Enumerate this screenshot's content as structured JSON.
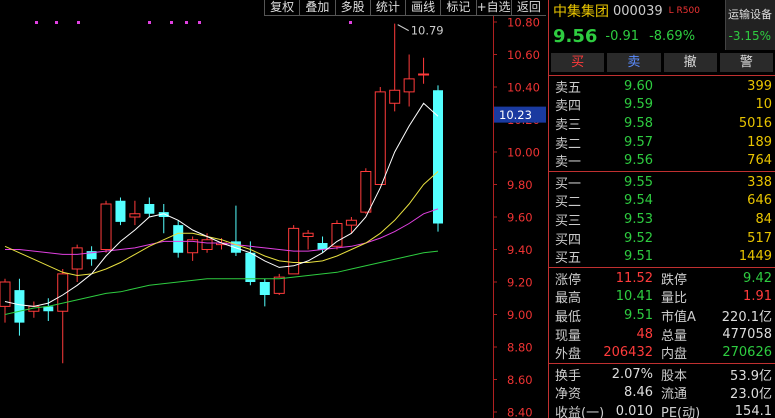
{
  "toolbar": [
    "复权",
    "叠加",
    "多股",
    "统计",
    "画线",
    "标记",
    "+自选",
    "返回"
  ],
  "stock": {
    "name": "中集集团",
    "code": "000039",
    "badge": "L R500",
    "price": "9.56",
    "change": "-0.91",
    "change_pct": "-8.69%",
    "sector_name": "运输设备",
    "sector_pct": "-3.15%"
  },
  "buttons": [
    "买",
    "卖",
    "撤",
    "警"
  ],
  "asks": [
    {
      "label": "卖五",
      "price": "9.60",
      "qty": "399"
    },
    {
      "label": "卖四",
      "price": "9.59",
      "qty": "10"
    },
    {
      "label": "卖三",
      "price": "9.58",
      "qty": "5016"
    },
    {
      "label": "卖二",
      "price": "9.57",
      "qty": "189"
    },
    {
      "label": "卖一",
      "price": "9.56",
      "qty": "764"
    }
  ],
  "bids": [
    {
      "label": "买一",
      "price": "9.55",
      "qty": "338"
    },
    {
      "label": "买二",
      "price": "9.54",
      "qty": "646"
    },
    {
      "label": "买三",
      "price": "9.53",
      "qty": "84"
    },
    {
      "label": "买四",
      "price": "9.52",
      "qty": "517"
    },
    {
      "label": "买五",
      "price": "9.51",
      "qty": "1449"
    }
  ],
  "stats1": [
    {
      "k1": "涨停",
      "v1": "11.52",
      "c1": "red",
      "k2": "跌停",
      "v2": "9.42",
      "c2": "green"
    },
    {
      "k1": "最高",
      "v1": "10.41",
      "c1": "green",
      "k2": "量比",
      "v2": "1.91",
      "c2": "red"
    },
    {
      "k1": "最低",
      "v1": "9.51",
      "c1": "green",
      "k2": "市值A",
      "v2": "220.1亿",
      "c2": "white"
    },
    {
      "k1": "现量",
      "v1": "48",
      "c1": "red",
      "k2": "总量",
      "v2": "477058",
      "c2": "white"
    },
    {
      "k1": "外盘",
      "v1": "206432",
      "c1": "red",
      "k2": "内盘",
      "v2": "270626",
      "c2": "green"
    }
  ],
  "stats2": [
    {
      "k1": "换手",
      "v1": "2.07%",
      "c1": "white",
      "k2": "股本",
      "v2": "53.9亿",
      "c2": "white"
    },
    {
      "k1": "净资",
      "v1": "8.46",
      "c1": "white",
      "k2": "流通",
      "v2": "23.0亿",
      "c2": "white"
    },
    {
      "k1": "收益(一)",
      "v1": "0.010",
      "c1": "white",
      "k2": "PE(动)",
      "v2": "154.1",
      "c2": "white"
    }
  ],
  "chart_data": {
    "type": "candlestick",
    "ylim": [
      8.4,
      10.9
    ],
    "y_ticks": [
      "10.80",
      "10.60",
      "10.40",
      "10.20",
      "10.00",
      "9.80",
      "9.60",
      "9.40",
      "9.20",
      "9.00",
      "8.80",
      "8.60",
      "8.40"
    ],
    "current_price_label": "10.23",
    "max_annotation": "10.79",
    "candles": [
      {
        "o": 9.05,
        "h": 9.22,
        "l": 8.95,
        "c": 9.2
      },
      {
        "o": 9.15,
        "h": 9.22,
        "l": 8.87,
        "c": 8.95
      },
      {
        "o": 9.02,
        "h": 9.08,
        "l": 8.98,
        "c": 9.05
      },
      {
        "o": 9.05,
        "h": 9.1,
        "l": 8.96,
        "c": 9.02
      },
      {
        "o": 9.02,
        "h": 9.28,
        "l": 8.7,
        "c": 9.25
      },
      {
        "o": 9.28,
        "h": 9.43,
        "l": 9.2,
        "c": 9.41
      },
      {
        "o": 9.39,
        "h": 9.42,
        "l": 9.3,
        "c": 9.34
      },
      {
        "o": 9.4,
        "h": 9.7,
        "l": 9.38,
        "c": 9.68
      },
      {
        "o": 9.7,
        "h": 9.72,
        "l": 9.55,
        "c": 9.57
      },
      {
        "o": 9.6,
        "h": 9.7,
        "l": 9.55,
        "c": 9.62
      },
      {
        "o": 9.68,
        "h": 9.72,
        "l": 9.6,
        "c": 9.62
      },
      {
        "o": 9.63,
        "h": 9.68,
        "l": 9.5,
        "c": 9.6
      },
      {
        "o": 9.55,
        "h": 9.58,
        "l": 9.35,
        "c": 9.38
      },
      {
        "o": 9.38,
        "h": 9.48,
        "l": 9.33,
        "c": 9.46
      },
      {
        "o": 9.4,
        "h": 9.5,
        "l": 9.38,
        "c": 9.46
      },
      {
        "o": 9.43,
        "h": 9.47,
        "l": 9.4,
        "c": 9.44
      },
      {
        "o": 9.45,
        "h": 9.67,
        "l": 9.36,
        "c": 9.38
      },
      {
        "o": 9.38,
        "h": 9.45,
        "l": 9.18,
        "c": 9.2
      },
      {
        "o": 9.2,
        "h": 9.22,
        "l": 9.05,
        "c": 9.12
      },
      {
        "o": 9.13,
        "h": 9.25,
        "l": 9.12,
        "c": 9.23
      },
      {
        "o": 9.25,
        "h": 9.55,
        "l": 9.25,
        "c": 9.53
      },
      {
        "o": 9.48,
        "h": 9.52,
        "l": 9.4,
        "c": 9.5
      },
      {
        "o": 9.44,
        "h": 9.48,
        "l": 9.38,
        "c": 9.4
      },
      {
        "o": 9.42,
        "h": 9.58,
        "l": 9.4,
        "c": 9.56
      },
      {
        "o": 9.55,
        "h": 9.6,
        "l": 9.5,
        "c": 9.58
      },
      {
        "o": 9.63,
        "h": 9.9,
        "l": 9.62,
        "c": 9.88
      },
      {
        "o": 9.8,
        "h": 10.4,
        "l": 9.8,
        "c": 10.37
      },
      {
        "o": 10.3,
        "h": 10.79,
        "l": 10.25,
        "c": 10.38
      },
      {
        "o": 10.37,
        "h": 10.6,
        "l": 10.28,
        "c": 10.45
      },
      {
        "o": 10.48,
        "h": 10.58,
        "l": 10.42,
        "c": 10.48
      },
      {
        "o": 10.38,
        "h": 10.41,
        "l": 9.51,
        "c": 9.56
      }
    ],
    "ma_white": [
      9.08,
      9.06,
      9.05,
      9.07,
      9.12,
      9.18,
      9.25,
      9.36,
      9.45,
      9.52,
      9.6,
      9.62,
      9.58,
      9.52,
      9.48,
      9.44,
      9.41,
      9.38,
      9.33,
      9.29,
      9.3,
      9.33,
      9.38,
      9.45,
      9.5,
      9.6,
      9.78,
      10.0,
      10.16,
      10.3,
      10.22
    ],
    "ma_yellow": [
      9.42,
      9.38,
      9.34,
      9.3,
      9.26,
      9.24,
      9.25,
      9.28,
      9.32,
      9.37,
      9.42,
      9.46,
      9.5,
      9.5,
      9.48,
      9.46,
      9.43,
      9.4,
      9.36,
      9.33,
      9.32,
      9.32,
      9.33,
      9.36,
      9.4,
      9.44,
      9.5,
      9.58,
      9.68,
      9.8,
      9.88
    ],
    "ma_magenta": [
      9.4,
      9.4,
      9.39,
      9.38,
      9.37,
      9.37,
      9.38,
      9.39,
      9.4,
      9.41,
      9.43,
      9.45,
      9.45,
      9.45,
      9.44,
      9.44,
      9.43,
      9.42,
      9.41,
      9.4,
      9.39,
      9.39,
      9.4,
      9.41,
      9.42,
      9.44,
      9.47,
      9.51,
      9.56,
      9.62,
      9.65
    ],
    "ma_green": [
      9.0,
      9.02,
      9.04,
      9.05,
      9.07,
      9.09,
      9.11,
      9.13,
      9.14,
      9.16,
      9.18,
      9.19,
      9.2,
      9.21,
      9.22,
      9.22,
      9.22,
      9.22,
      9.22,
      9.22,
      9.23,
      9.24,
      9.25,
      9.26,
      9.28,
      9.3,
      9.32,
      9.34,
      9.36,
      9.38,
      9.39
    ]
  }
}
